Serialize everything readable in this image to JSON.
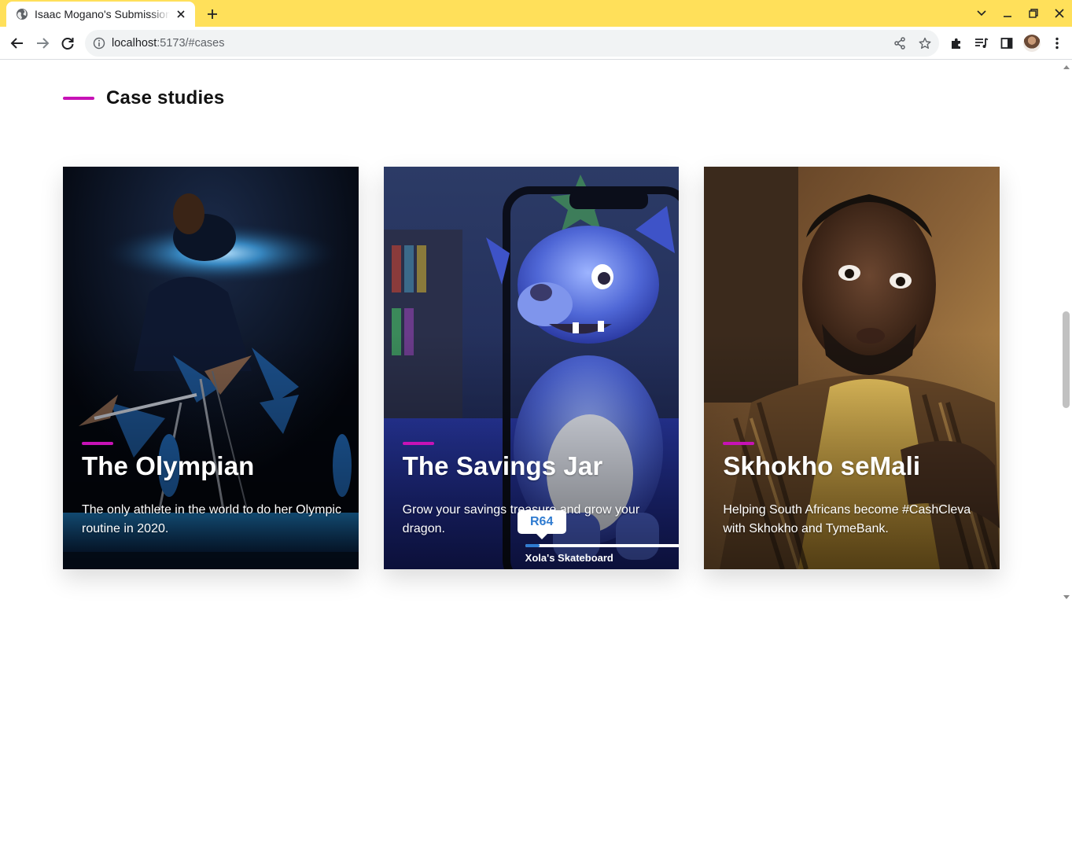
{
  "browser": {
    "tab_title": "Isaac Mogano's Submission",
    "url_host": "localhost",
    "url_path": ":5173/#cases"
  },
  "page": {
    "section_title": "Case studies",
    "accent_color": "#c712b6",
    "cards": [
      {
        "title": "The Olympian",
        "description": "The only athlete in the world to do her Olympic routine in 2020."
      },
      {
        "title": "The Savings Jar",
        "description": "Grow your savings treasure and grow your dragon.",
        "price_tag": "R64",
        "caption": "Xola's Skateboard"
      },
      {
        "title": "Skhokho seMali",
        "description": "Helping South Africans become #CashCleva with Skhokho and TymeBank."
      }
    ]
  },
  "icons": {
    "tab_favicon": "globe-icon",
    "tab_close": "close-icon",
    "new_tab": "plus-icon",
    "back": "arrow-left-icon",
    "forward": "arrow-right-icon",
    "reload": "reload-icon",
    "site_info": "info-icon",
    "share": "share-icon",
    "bookmark": "star-icon",
    "extensions": "puzzle-icon",
    "reading_list": "playlist-icon",
    "side_panel": "side-panel-icon",
    "menu": "kebab-menu-icon"
  }
}
